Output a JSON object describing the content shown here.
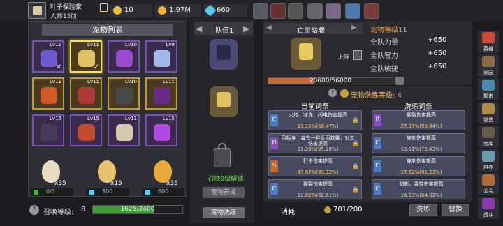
{
  "player": {
    "name": "叶子探险家",
    "rank": "大师15阶"
  },
  "resources": {
    "gold": "10",
    "coins": "1.97M",
    "gems": "660"
  },
  "pet_list": {
    "title": "宠物列表",
    "cards": [
      {
        "level": "Lv11",
        "rarity": "purple",
        "mark": "✕",
        "color": "#6a5acd"
      },
      {
        "level": "Lv11",
        "rarity": "gold",
        "mark": "✓",
        "color": "#e0c060",
        "selected": true
      },
      {
        "level": "Lv10",
        "rarity": "purple",
        "mark": "",
        "color": "#9a4ad0"
      },
      {
        "level": "Lv8",
        "rarity": "purple",
        "mark": "",
        "color": "#a0b8e8"
      },
      {
        "level": "Lv11",
        "rarity": "gold",
        "mark": "",
        "color": "#d05a2a"
      },
      {
        "level": "Lv11",
        "rarity": "gold",
        "mark": "",
        "color": "#b03a3a"
      },
      {
        "level": "Lv10",
        "rarity": "gold",
        "mark": "",
        "color": "#4a4a4a"
      },
      {
        "level": "Lv11",
        "rarity": "gold",
        "mark": "",
        "color": "#6a2a8a"
      },
      {
        "level": "Lv15",
        "rarity": "purple",
        "mark": "",
        "color": "#4a3a5a"
      },
      {
        "level": "Lv15",
        "rarity": "purple",
        "mark": "",
        "color": "#c04a2a"
      },
      {
        "level": "Lv11",
        "rarity": "purple",
        "mark": "",
        "color": "#d8c8b0"
      },
      {
        "level": "Lv15",
        "rarity": "purple",
        "mark": "",
        "color": "#b04ae0"
      }
    ]
  },
  "eggs": [
    {
      "count": "x35",
      "cost": "0/3",
      "color": "#e8dcc0",
      "cost_icon": "ticket-icon"
    },
    {
      "count": "x15",
      "cost": "300",
      "color": "#e8c070",
      "cost_icon": "gem-icon"
    },
    {
      "count": "x35",
      "cost": "600",
      "color": "#e8a83a",
      "cost_icon": "gem-icon"
    }
  ],
  "summon": {
    "label": "召唤等级:",
    "level": "8",
    "progress_text": "1625/2400",
    "progress": 0.677
  },
  "team": {
    "label": "队伍1",
    "unlock_text": "召唤9级解锁",
    "unlock_btn": "宠物养成",
    "train_btn": "宠物洗练"
  },
  "detail": {
    "pet_name": "亡灵骷髅",
    "pet_level_label": "宠物等级11",
    "deploy_label": "上阵",
    "stats": [
      {
        "name": "全队力量",
        "value": "+650"
      },
      {
        "name": "全队智力",
        "value": "+650"
      },
      {
        "name": "全队敏捷",
        "value": "+650"
      }
    ],
    "exp_text": "20600/56000",
    "exp_progress": 0.368
  },
  "traits": {
    "title": "宠物洗练等级: 4",
    "current_label": "当前词条",
    "wash_label": "洗练词条",
    "current": [
      {
        "grade": "C",
        "desc": "火焰、冰冻、闪电伤害提高",
        "value": "13.15%(68.47%)",
        "color": "#4a7ac8"
      },
      {
        "grade": "B",
        "desc": "目标身上每有一种负面效果，对其伤害提高",
        "value": "13.28%(95.28%)",
        "color": "#8a4ac8"
      },
      {
        "grade": "S",
        "desc": "打击伤害提高",
        "value": "47.67%(99.32%)",
        "color": "#c8682a"
      },
      {
        "grade": "C",
        "desc": "撕裂伤害提高",
        "value": "12.02%(62.61%)",
        "color": "#4a7ac8"
      }
    ],
    "wash": [
      {
        "grade": "B",
        "desc": "撕裂伤害提高",
        "value": "27.37%(98.44%)",
        "color": "#8a4ac8"
      },
      {
        "grade": "C",
        "desc": "穿刺伤害提高",
        "value": "13.91%(72.43%)",
        "color": "#4a7ac8"
      },
      {
        "grade": "C",
        "desc": "穿刺伤害提高",
        "value": "17.52%(91.23%)",
        "color": "#4a7ac8"
      },
      {
        "grade": "C",
        "desc": "暗影、毒性伤害提高",
        "value": "16.13%(84.02%)",
        "color": "#4a7ac8"
      }
    ]
  },
  "bottom": {
    "consume_label": "消耗",
    "consume_value": "701/200",
    "wash_btn": "洗练",
    "replace_btn": "替换"
  },
  "nav": [
    {
      "label": "英雄",
      "color": "#d04a3a"
    },
    {
      "label": "家园",
      "color": "#8a6a4a"
    },
    {
      "label": "集市",
      "color": "#4a8ab0"
    },
    {
      "label": "锻造",
      "color": "#b08a4a"
    },
    {
      "label": "仓库",
      "color": "#6a5a4a"
    },
    {
      "label": "培养",
      "color": "#6a9ab0"
    },
    {
      "label": "公会",
      "color": "#b06a3a"
    },
    {
      "label": "战斗",
      "color": "#8a3ab0"
    }
  ]
}
